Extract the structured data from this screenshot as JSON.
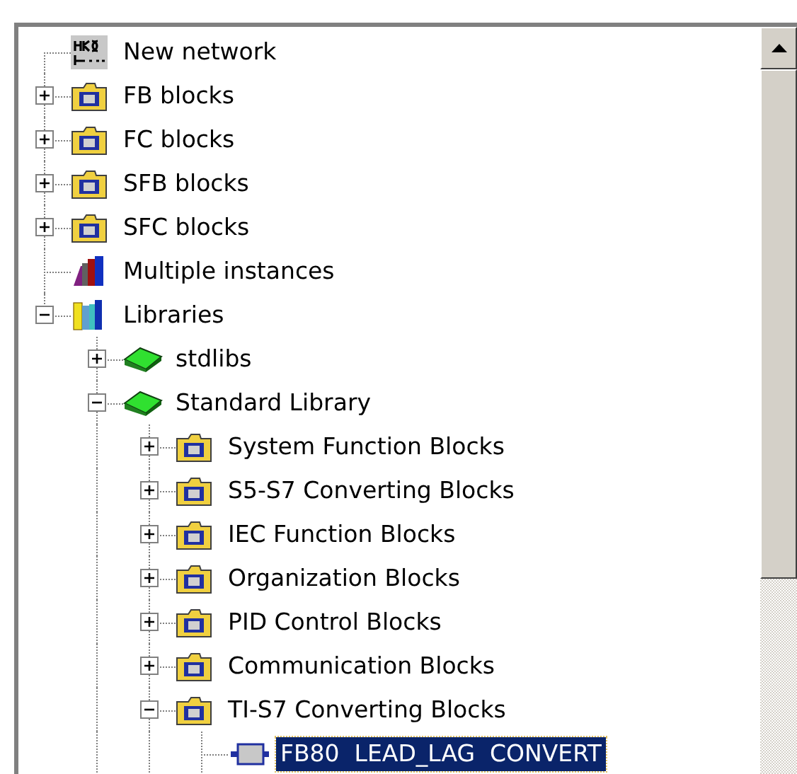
{
  "tree": [
    {
      "label": "New network",
      "kind": "network"
    },
    {
      "label": "FB blocks",
      "kind": "folder",
      "expanded": false
    },
    {
      "label": "FC blocks",
      "kind": "folder",
      "expanded": false
    },
    {
      "label": "SFB blocks",
      "kind": "folder",
      "expanded": false
    },
    {
      "label": "SFC blocks",
      "kind": "folder",
      "expanded": false
    },
    {
      "label": "Multiple instances",
      "kind": "instances"
    },
    {
      "label": "Libraries",
      "kind": "libraries",
      "expanded": true,
      "children": [
        {
          "label": "stdlibs",
          "kind": "book",
          "expanded": false
        },
        {
          "label": "Standard Library",
          "kind": "book",
          "expanded": true,
          "children": [
            {
              "label": "System Function Blocks",
              "kind": "folder",
              "expanded": false
            },
            {
              "label": "S5-S7 Converting Blocks",
              "kind": "folder",
              "expanded": false
            },
            {
              "label": "IEC Function Blocks",
              "kind": "folder",
              "expanded": false
            },
            {
              "label": "Organization Blocks",
              "kind": "folder",
              "expanded": false
            },
            {
              "label": "PID Control Blocks",
              "kind": "folder",
              "expanded": false
            },
            {
              "label": "Communication Blocks",
              "kind": "folder",
              "expanded": false
            },
            {
              "label": "TI-S7 Converting Blocks",
              "kind": "folder",
              "expanded": true,
              "children": [
                {
                  "label": "FB80  LEAD_LAG  CONVERT",
                  "kind": "block",
                  "selected": true
                }
              ]
            }
          ]
        }
      ]
    }
  ]
}
